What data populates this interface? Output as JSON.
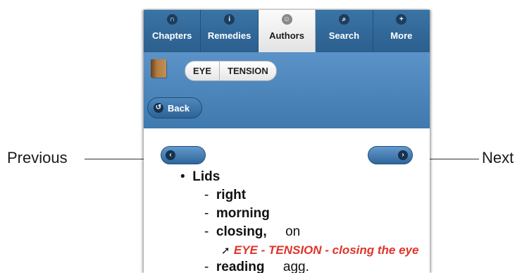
{
  "callouts": {
    "previous": "Previous",
    "next": "Next"
  },
  "nav": {
    "tabs": [
      {
        "label": "Chapters",
        "icon": "chapters-icon",
        "glyph": "∩"
      },
      {
        "label": "Remedies",
        "icon": "remedies-icon",
        "glyph": "i"
      },
      {
        "label": "Authors",
        "icon": "authors-icon",
        "glyph": "☺"
      },
      {
        "label": "Search",
        "icon": "search-icon",
        "glyph": "⌕"
      },
      {
        "label": "More",
        "icon": "plus-icon",
        "glyph": "+"
      }
    ],
    "active": "Authors"
  },
  "header": {
    "breadcrumb": [
      "EYE",
      "TENSION"
    ],
    "back_label": "Back"
  },
  "content": {
    "root": "Lids",
    "items": [
      {
        "label": "right"
      },
      {
        "label": "morning"
      },
      {
        "label": "closing,",
        "modifier": "on",
        "reference": "EYE - TENSION - closing the eye"
      },
      {
        "label": "reading",
        "modifier": "agg."
      }
    ]
  },
  "colors": {
    "nav_bg": "#2f6594",
    "header_bg": "#4f88bd",
    "reference": "#e0342a"
  }
}
